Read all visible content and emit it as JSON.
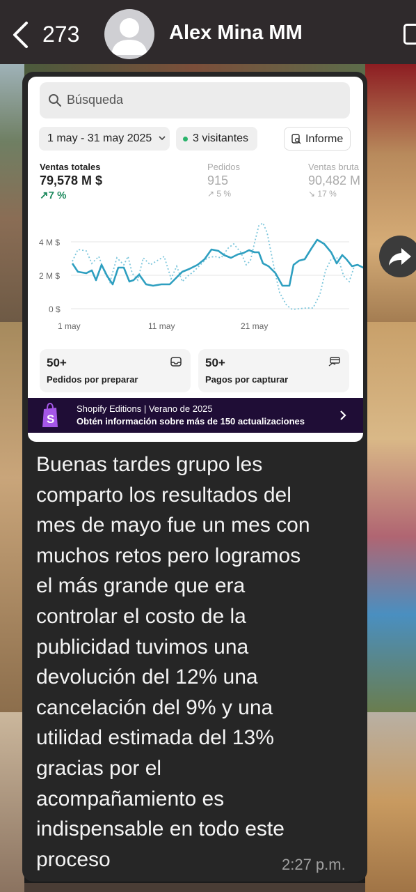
{
  "header": {
    "unread_count": "273",
    "contact_name": "Alex Mina MM"
  },
  "screenshot": {
    "search_placeholder": "Búsqueda",
    "date_range": "1 may - 31 may 2025",
    "visitors": "3 visitantes",
    "report_label": "Informe",
    "metrics": [
      {
        "label": "Ventas totales",
        "value": "79,578 M $",
        "change": "7 %"
      },
      {
        "label": "Pedidos",
        "value": "915",
        "change": "5 %"
      },
      {
        "label": "Ventas bruta",
        "value": "90,482 M",
        "change": "17 %"
      }
    ],
    "chart": {
      "y_ticks": [
        "4 M $",
        "2 M $",
        "0 $"
      ],
      "x_ticks": [
        "1 may",
        "11 may",
        "21 may"
      ]
    },
    "cards": [
      {
        "number": "50+",
        "label": "Pedidos por preparar"
      },
      {
        "number": "50+",
        "label": "Pagos por capturar"
      }
    ],
    "banner": {
      "title": "Shopify Editions | Verano de 2025",
      "subtitle": "Obtén información sobre más de 150 actualizaciones"
    }
  },
  "message": {
    "text": "Buenas tardes grupo les\ncomparto los resultados del\nmes de mayo fue un mes con\nmuchos retos pero logramos\nel más grande que era\ncontrolar el costo de la\npublicidad tuvimos una\ndevolución del 12% una\ncancelación del 9% y una\nutilidad estimada del 13%\ngracias por el\nacompañamiento es\nindispensable en todo este\nproceso",
    "time": "2:27 p.m."
  },
  "colors": {
    "header_bg": "#2f2a2c",
    "bubble_bg": "#262626",
    "line_primary": "#2e9fc0",
    "line_comparison": "#7cc6dc",
    "positive_change": "#1e8a5e",
    "banner_bg": "#1f0d36"
  },
  "icons": [
    "back-arrow-icon",
    "avatar-placeholder-icon",
    "menu-icon",
    "search-icon",
    "report-icon",
    "inbox-icon",
    "card-icon",
    "shopify-bag-icon",
    "chevron-right-icon",
    "forward-icon"
  ]
}
